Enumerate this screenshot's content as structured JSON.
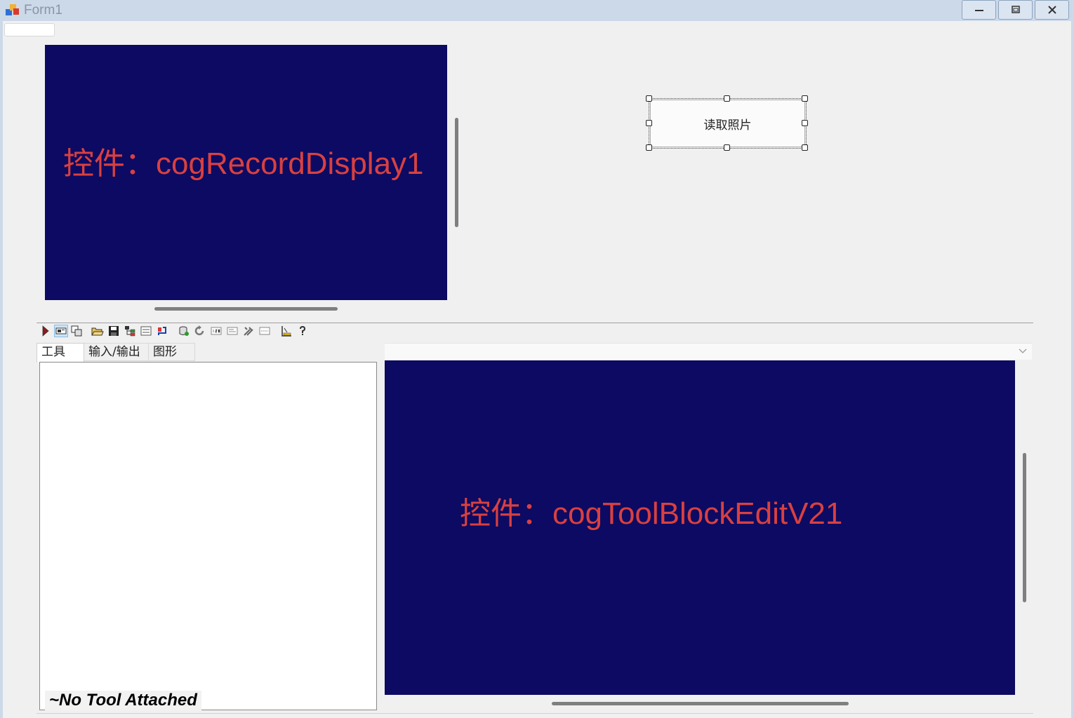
{
  "window": {
    "title": "Form1",
    "controls": {
      "minimize_icon": "minimize-icon",
      "maximize_icon": "restore-icon",
      "close_icon": "close-icon"
    }
  },
  "record_display": {
    "label": "控件：cogRecordDisplay1",
    "background_color": "#0c0a62",
    "label_color": "#d94040"
  },
  "read_photo_button": {
    "label": "读取照片"
  },
  "toolblock_edit": {
    "toolbar_icons": [
      "run-icon",
      "view-icon",
      "float-icon",
      "open-icon",
      "save-icon",
      "tree-icon",
      "list-icon",
      "reset-icon",
      "database-icon",
      "rotate-icon",
      "number-icon",
      "terminal-icon",
      "tools-icon",
      "debug-icon",
      "measure-icon",
      "help-icon"
    ],
    "tabs": [
      {
        "label": "工具"
      },
      {
        "label": "输入/输出"
      },
      {
        "label": "图形"
      }
    ],
    "no_tool_text": "~No Tool Attached",
    "image_combo_value": "",
    "display_label": "控件：cogToolBlockEditV21"
  }
}
